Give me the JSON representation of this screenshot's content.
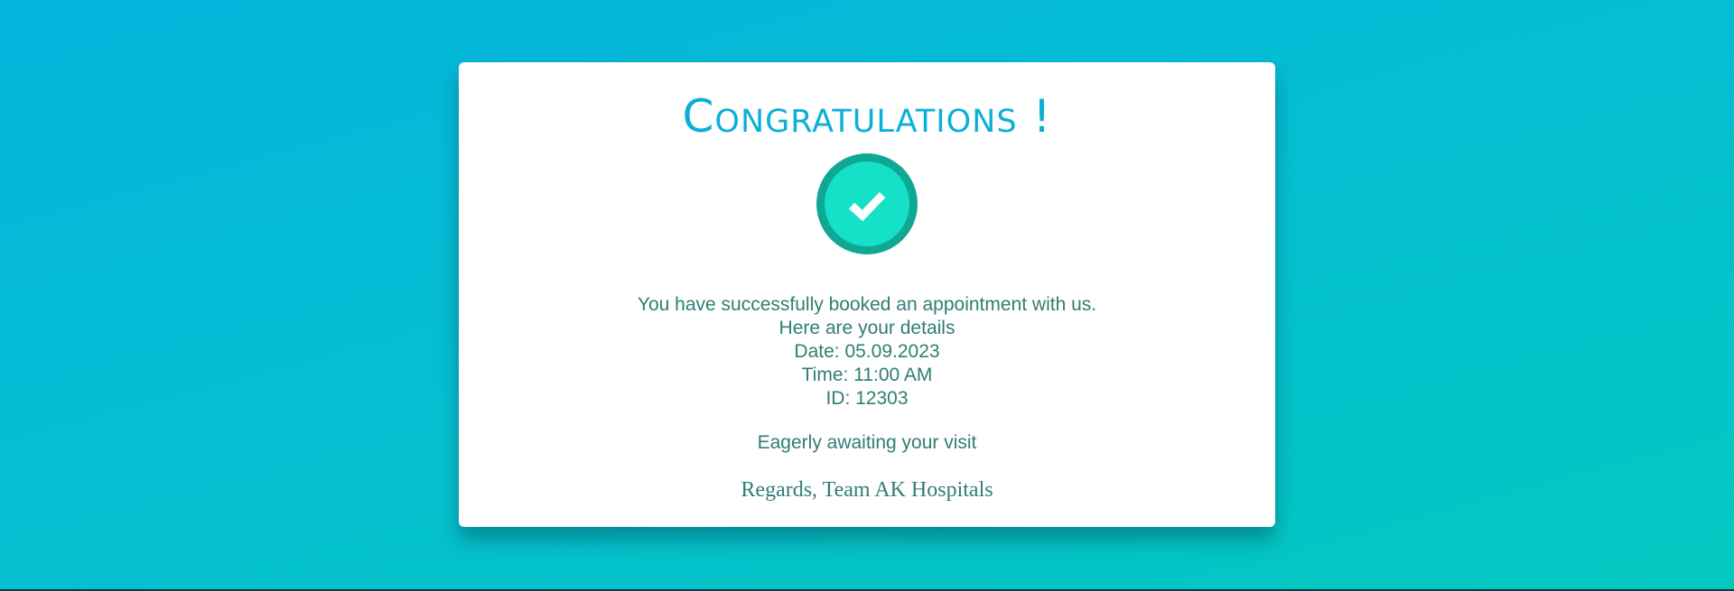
{
  "card": {
    "title": "Congratulations !",
    "icon": "check-circle-icon",
    "message_lines": [
      "You have successfully booked an appointment with us.",
      "Here are your details",
      "Date: 05.09.2023",
      "Time: 11:00 AM",
      "ID: 12303"
    ],
    "awaiting": "Eagerly awaiting your visit",
    "regards": "Regards, Team AK Hospitals"
  },
  "colors": {
    "background_start": "#03b5dc",
    "background_end": "#03c8bf",
    "title": "#0ab0d8",
    "text": "#2f7e74",
    "check_ring": "#0ea894",
    "check_fill": "#14e1c7"
  }
}
